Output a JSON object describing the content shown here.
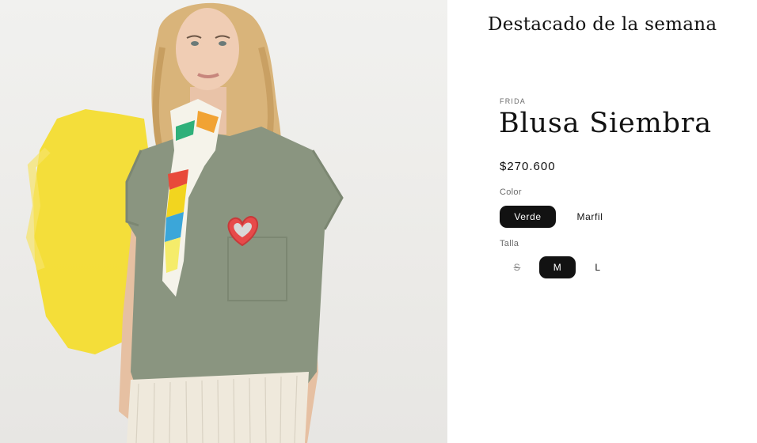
{
  "section": {
    "heading": "Destacado de la semana"
  },
  "product": {
    "vendor": "FRIDA",
    "title": "Blusa Siembra",
    "price": "$270.600",
    "image": {
      "subject": "product-photo-model"
    }
  },
  "options": {
    "color": {
      "label": "Color",
      "values": [
        {
          "label": "Verde",
          "selected": true,
          "available": true
        },
        {
          "label": "Marfil",
          "selected": false,
          "available": true
        }
      ]
    },
    "size": {
      "label": "Talla",
      "values": [
        {
          "label": "S",
          "selected": false,
          "available": false
        },
        {
          "label": "M",
          "selected": true,
          "available": true
        },
        {
          "label": "L",
          "selected": false,
          "available": true
        }
      ]
    }
  },
  "colors": {
    "text": "#121212",
    "muted": "#6b6b6b",
    "selected_pill_bg": "#121212",
    "selected_pill_text": "#ffffff",
    "blouse": "#8a9580",
    "accent_yellow": "#f4dc2a"
  }
}
